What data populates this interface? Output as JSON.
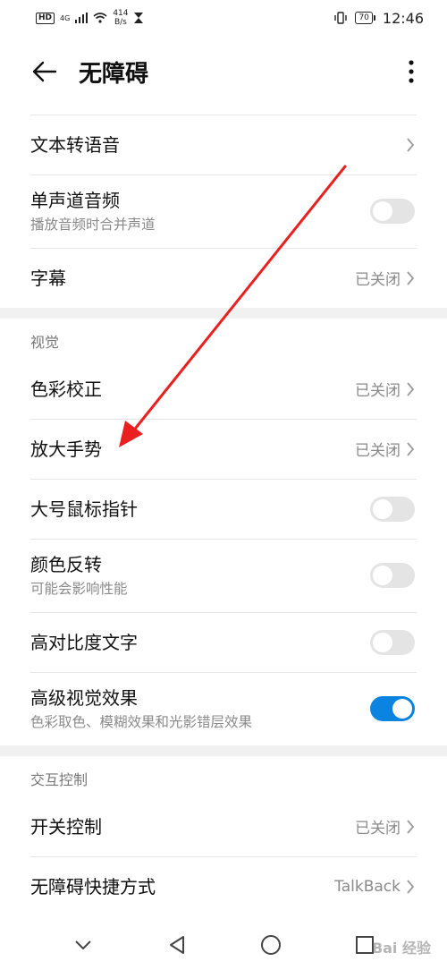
{
  "status_bar": {
    "hd": "HD",
    "signal": "4G",
    "speed_value": "414",
    "speed_unit": "B/s",
    "battery": "70",
    "time": "12:46"
  },
  "header": {
    "title": "无障碍"
  },
  "items": {
    "tts": {
      "title": "文本转语音"
    },
    "mono": {
      "title": "单声道音频",
      "sub": "播放音频时合并声道",
      "on": false
    },
    "captions": {
      "title": "字幕",
      "value": "已关闭"
    },
    "color_correct": {
      "title": "色彩校正",
      "value": "已关闭"
    },
    "magnify": {
      "title": "放大手势",
      "value": "已关闭"
    },
    "big_pointer": {
      "title": "大号鼠标指针",
      "on": false
    },
    "invert": {
      "title": "颜色反转",
      "sub": "可能会影响性能",
      "on": false
    },
    "high_contrast": {
      "title": "高对比度文字",
      "on": false
    },
    "advanced_visual": {
      "title": "高级视觉效果",
      "sub": "色彩取色、模糊效果和光影错层效果",
      "on": true
    },
    "switch_control": {
      "title": "开关控制",
      "value": "已关闭"
    },
    "shortcut": {
      "title": "无障碍快捷方式",
      "value": "TalkBack"
    }
  },
  "sections": {
    "vision": "视觉",
    "interaction": "交互控制"
  },
  "icons": {
    "back": "arrow-left-icon",
    "more": "more-vertical-icon",
    "chevron": "chevron-right-icon",
    "nav_down": "chevron-down-icon",
    "nav_back": "triangle-back-icon",
    "nav_home": "circle-home-icon",
    "nav_recent": "square-recent-icon"
  },
  "colors": {
    "toggle_on": "#0a84e0",
    "toggle_off": "#e4e4e4",
    "annotation_arrow": "#e8201f"
  },
  "watermark": "Bai 经验"
}
